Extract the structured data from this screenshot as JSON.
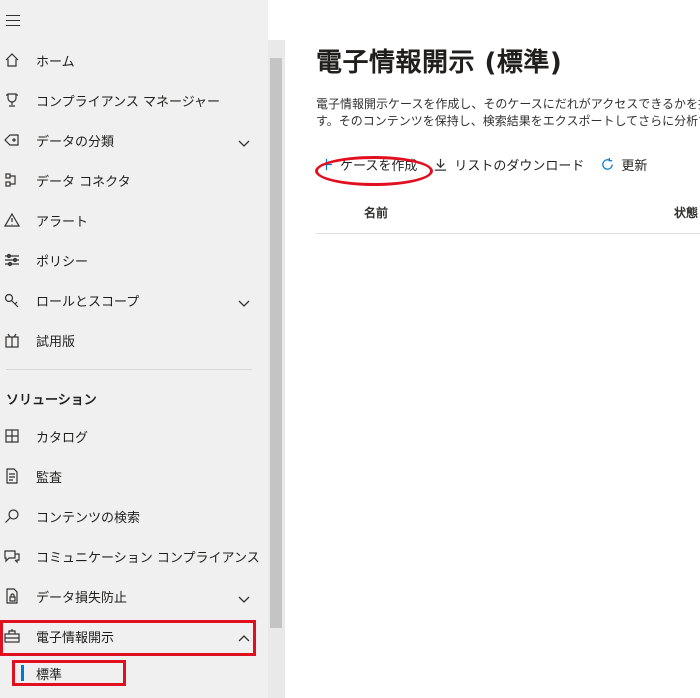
{
  "sidebar": {
    "items": [
      {
        "label": "ホーム",
        "icon": "home-icon"
      },
      {
        "label": "コンプライアンス マネージャー",
        "icon": "trophy-icon"
      },
      {
        "label": "データの分類",
        "icon": "tag-icon",
        "expandable": true
      },
      {
        "label": "データ コネクタ",
        "icon": "connector-icon"
      },
      {
        "label": "アラート",
        "icon": "warning-icon"
      },
      {
        "label": "ポリシー",
        "icon": "sliders-icon"
      },
      {
        "label": "ロールとスコープ",
        "icon": "key-icon",
        "expandable": true
      },
      {
        "label": "試用版",
        "icon": "trial-icon"
      }
    ],
    "section_header": "ソリューション",
    "solution_items": [
      {
        "label": "カタログ",
        "icon": "catalog-icon"
      },
      {
        "label": "監査",
        "icon": "audit-icon"
      },
      {
        "label": "コンテンツの検索",
        "icon": "search-icon"
      },
      {
        "label": "コミュニケーション コンプライアンス",
        "icon": "chat-icon"
      },
      {
        "label": "データ損失防止",
        "icon": "lock-icon",
        "expandable": true
      },
      {
        "label": "電子情報開示",
        "icon": "briefcase-icon",
        "expanded": true
      }
    ],
    "sub_item": {
      "label": "標準"
    }
  },
  "main": {
    "title": "電子情報開示 (標準)",
    "description_line1": "電子情報開示ケースを作成し、そのケースにだれがアクセスできるかを指",
    "description_line2": "す。そのコンテンツを保持し、検索結果をエクスポートしてさらに分析する",
    "toolbar": {
      "create_label": "ケースを作成",
      "download_label": "リストのダウンロード",
      "refresh_label": "更新"
    },
    "table": {
      "columns": [
        "名前",
        "状態"
      ]
    }
  },
  "colors": {
    "accent": "#0078d4",
    "highlight": "#e01020",
    "sidebar_bg": "#f0f0f0"
  }
}
